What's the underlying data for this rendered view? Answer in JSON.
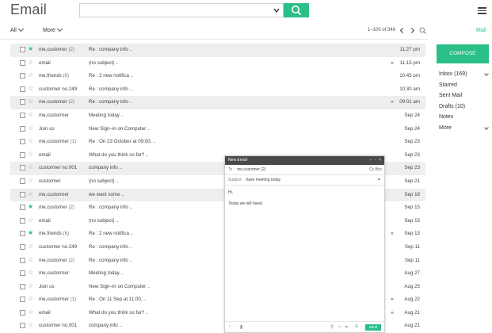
{
  "header": {
    "title": "Email",
    "search_value": ""
  },
  "toolbar": {
    "all_label": "All",
    "more_label": "More",
    "pager": "1–100 of 346",
    "mail_link": "Mail"
  },
  "messages": [
    {
      "sender": "me,customer",
      "count": "(2)",
      "subject": "Re : company info ..",
      "date": "11:27 pm",
      "shaded": true,
      "starred": true,
      "clip": false
    },
    {
      "sender": "email",
      "count": "",
      "subject": "(no subject) ..",
      "date": "11:15 pm",
      "shaded": false,
      "starred": false,
      "clip": true
    },
    {
      "sender": "me,friends",
      "count": "(6)",
      "subject": "Re : 2 new notifica ..",
      "date": "10:45 pm",
      "shaded": false,
      "starred": false,
      "clip": false
    },
    {
      "sender": "custormer no.249",
      "count": "",
      "subject": "Re : company info ..",
      "date": "10:30 am",
      "shaded": false,
      "starred": false,
      "clip": false
    },
    {
      "sender": "me,customer",
      "count": "(2)",
      "subject": "Re : company info ..",
      "date": "09:01 am",
      "shaded": true,
      "starred": false,
      "clip": true
    },
    {
      "sender": "me,custormer",
      "count": "",
      "subject": "Meeting today ..",
      "date": "Sep 24",
      "shaded": false,
      "starred": false,
      "clip": false
    },
    {
      "sender": "Join us",
      "count": "",
      "subject": "New Sign–in on Computer ..",
      "date": "Sep 24",
      "shaded": false,
      "starred": false,
      "clip": false
    },
    {
      "sender": "me,custormer",
      "count": "(1)",
      "subject": "Re : On 23 October at 09:00, ..",
      "date": "Sep 23",
      "shaded": false,
      "starred": false,
      "clip": false
    },
    {
      "sender": "email",
      "count": "",
      "subject": "What do you think so far? ..",
      "date": "Sep 23",
      "shaded": false,
      "starred": false,
      "clip": false
    },
    {
      "sender": "custormer no.001",
      "count": "",
      "subject": "company info ..",
      "date": "Sep 23",
      "shaded": true,
      "starred": false,
      "clip": false
    },
    {
      "sender": "custormer",
      "count": "",
      "subject": "(no subject) ..",
      "date": "Sep 21",
      "shaded": false,
      "starred": false,
      "clip": false
    },
    {
      "sender": "me,custormer",
      "count": "",
      "subject": "we want some ..",
      "date": "Sep 18",
      "shaded": true,
      "starred": false,
      "clip": false
    },
    {
      "sender": "me,customer",
      "count": "(2)",
      "subject": "Re : company info ..",
      "date": "Sep 15",
      "shaded": false,
      "starred": true,
      "clip": false
    },
    {
      "sender": "email",
      "count": "",
      "subject": "(no subject) ..",
      "date": "Sep 15",
      "shaded": false,
      "starred": false,
      "clip": false
    },
    {
      "sender": "me,friends",
      "count": "(6)",
      "subject": "Re : 2 new notifica ..",
      "date": "Sep 13",
      "shaded": false,
      "starred": true,
      "clip": true
    },
    {
      "sender": "custormer no.249",
      "count": "",
      "subject": "Re : company info ..",
      "date": "Sep 11",
      "shaded": false,
      "starred": false,
      "clip": false
    },
    {
      "sender": "me,customer",
      "count": "(2)",
      "subject": "Re : company info ..",
      "date": "Sep 11",
      "shaded": false,
      "starred": false,
      "clip": false
    },
    {
      "sender": "me,custormer",
      "count": "",
      "subject": "Meeting today ..",
      "date": "Aug 27",
      "shaded": false,
      "starred": false,
      "clip": false
    },
    {
      "sender": "Join us",
      "count": "",
      "subject": "New Sign–in on Computer ..",
      "date": "Aug 25",
      "shaded": false,
      "starred": false,
      "clip": false
    },
    {
      "sender": "me,custormer",
      "count": "(1)",
      "subject": "Re : On 11 Sep at 11:00, ..",
      "date": "Aug 22",
      "shaded": false,
      "starred": false,
      "clip": true
    },
    {
      "sender": "email",
      "count": "",
      "subject": "What do you think so far? ..",
      "date": "Aug 21",
      "shaded": false,
      "starred": false,
      "clip": true
    },
    {
      "sender": "custormer no.001",
      "count": "",
      "subject": "company info ..",
      "date": "Aug 21",
      "shaded": false,
      "starred": false,
      "clip": false
    }
  ],
  "sidebar": {
    "compose_label": "COMPOSE",
    "folders": [
      {
        "label": "Inbox  (169)",
        "chevron": true
      },
      {
        "label": "Starred",
        "chevron": false
      },
      {
        "label": "Sent Mail",
        "chevron": false
      },
      {
        "label": "Drafts  (10)",
        "chevron": false
      },
      {
        "label": "Notes",
        "chevron": false
      },
      {
        "label": "More",
        "chevron": true
      }
    ]
  },
  "compose_window": {
    "title": "New Email",
    "to_label": "To :",
    "to_value": "me,customer (2)",
    "cc_bcc": "Cc  Bcc",
    "subject_label": "Subject :",
    "subject_value": "have meeting today",
    "body_greeting": "Hi,",
    "body_line": "Today we will have|",
    "send_label": "Send"
  },
  "colors": {
    "accent": "#2bbf88"
  }
}
